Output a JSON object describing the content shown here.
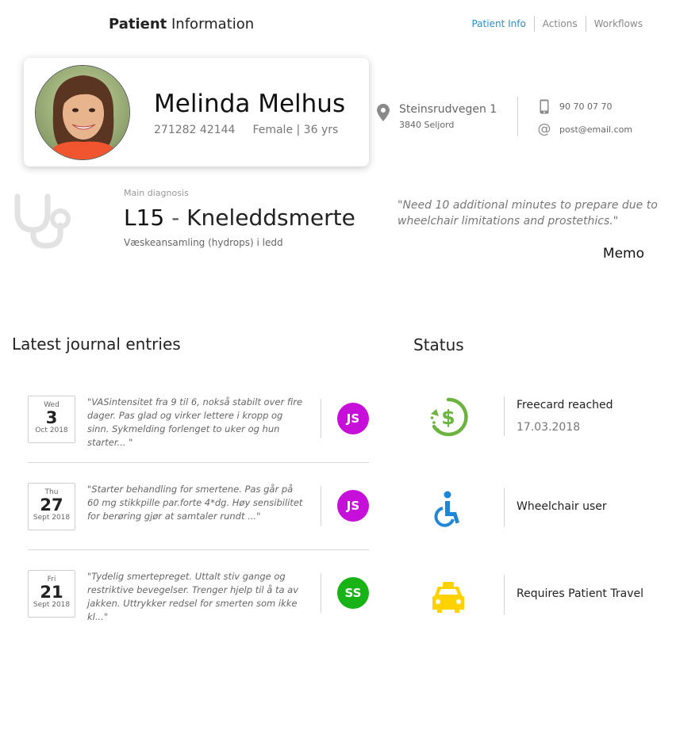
{
  "header": {
    "title_bold": "Patient",
    "title_rest": "Information",
    "nav": [
      {
        "label": "Patient Info",
        "active": true
      },
      {
        "label": "Actions",
        "active": false
      },
      {
        "label": "Workflows",
        "active": false
      }
    ]
  },
  "patient": {
    "name": "Melinda Melhus",
    "id": "271282 42144",
    "gender_age": "Female | 36 yrs"
  },
  "address": {
    "street": "Steinsrudvegen 1",
    "postal": "3840 Seljord"
  },
  "contact": {
    "phone": "90 70 07 70",
    "email": "post@email.com"
  },
  "diagnosis": {
    "label": "Main diagnosis",
    "code": "L15",
    "dash": " - ",
    "name": "Kneleddsmerte",
    "description": "Væskeansamling (hydrops) i ledd"
  },
  "memo": {
    "text": "\"Need 10 additional minutes to prepare due to wheelchair limitations and prostethics.\"",
    "button_label": "Memo"
  },
  "journal": {
    "title": "Latest journal entries",
    "entries": [
      {
        "weekday": "Wed",
        "day": "3",
        "month": "Oct 2018",
        "text": "\"VASintensitet fra 9 til 6, nokså stabilt over fire dager. Pas glad og virker lettere i kropp og sinn. Sykmelding forlenget to uker og hun starter... \"",
        "initials": "JS",
        "color": "#c60fd9"
      },
      {
        "weekday": "Thu",
        "day": "27",
        "month": "Sept 2018",
        "text": "\"Starter behandling for smertene. Pas går på 60 mg stikkpille par.forte 4*dg. Høy sensibilitet for berøring  gjør at samtaler rundt ...\"",
        "initials": "JS",
        "color": "#c60fd9"
      },
      {
        "weekday": "Fri",
        "day": "21",
        "month": "Sept 2018",
        "text": "\"Tydelig smertepreget. Uttalt stiv gange og restriktive bevegelser. Trenger hjelp til å ta av jakken. Uttrykker redsel for smerten som ikke kl...\"",
        "initials": "SS",
        "color": "#17b317"
      }
    ]
  },
  "status": {
    "title": "Status",
    "items": [
      {
        "icon": "freecard-dollar-icon",
        "label": "Freecard reached",
        "date": "17.03.2018",
        "color": "#6db33f"
      },
      {
        "icon": "wheelchair-icon",
        "label": "Wheelchair user",
        "color": "#1e88d6"
      },
      {
        "icon": "taxi-icon",
        "label": "Requires Patient Travel",
        "color": "#ffd200"
      }
    ]
  }
}
